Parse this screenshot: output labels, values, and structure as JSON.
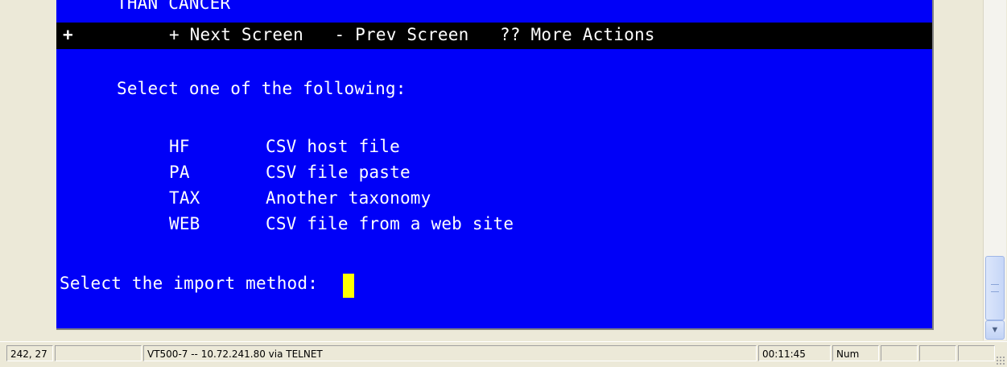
{
  "terminal": {
    "cutoff_text": "THAN CANCER",
    "action_bar": {
      "plus_marker": "+",
      "actions": "+ Next Screen   - Prev Screen   ?? More Actions"
    },
    "heading": "Select one of the following:",
    "options": [
      {
        "code": "HF",
        "label": "CSV host file"
      },
      {
        "code": "PA",
        "label": "CSV file paste"
      },
      {
        "code": "TAX",
        "label": "Another taxonomy"
      },
      {
        "code": "WEB",
        "label": "CSV file from a web site"
      }
    ],
    "prompt": "Select the import method: ",
    "colors": {
      "background": "#0000f8",
      "text": "#ffffff",
      "cursor": "#ffff00"
    }
  },
  "statusbar": {
    "cursor_position": "242, 27",
    "connection": "VT500-7 -- 10.72.241.80 via TELNET",
    "elapsed": "00:11:45",
    "num_lock": "Num"
  }
}
